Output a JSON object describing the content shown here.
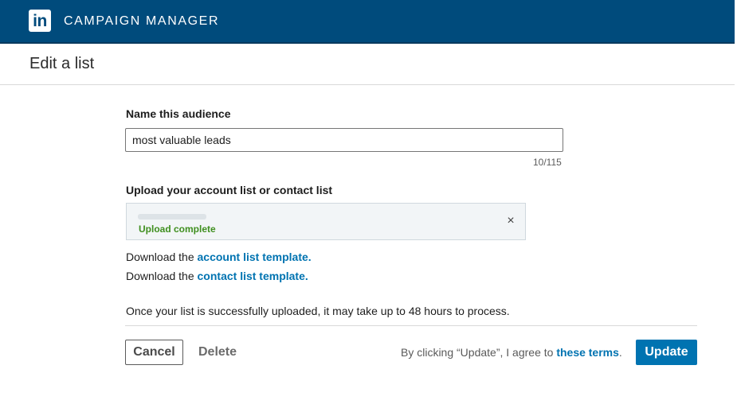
{
  "header": {
    "logo_text": "in",
    "app_title": "CAMPAIGN MANAGER",
    "brand_color": "#004b7c"
  },
  "page": {
    "title": "Edit a list"
  },
  "form": {
    "name_label": "Name this audience",
    "name_value": "most valuable leads",
    "char_counter": "10/115",
    "upload_label": "Upload your account list or contact list",
    "upload_status": "Upload complete",
    "close_icon": "×",
    "template_prefix": "Download the",
    "account_template_link": "account list template.",
    "contact_template_link": "contact list template.",
    "processing_note": "Once your list is successfully uploaded, it may take up to 48 hours to process."
  },
  "footer": {
    "cancel_label": "Cancel",
    "delete_label": "Delete",
    "terms_text": "By clicking “Update”, I agree to",
    "terms_link": "these terms",
    "terms_suffix": ".",
    "update_label": "Update",
    "accent_color": "#0073b1"
  }
}
